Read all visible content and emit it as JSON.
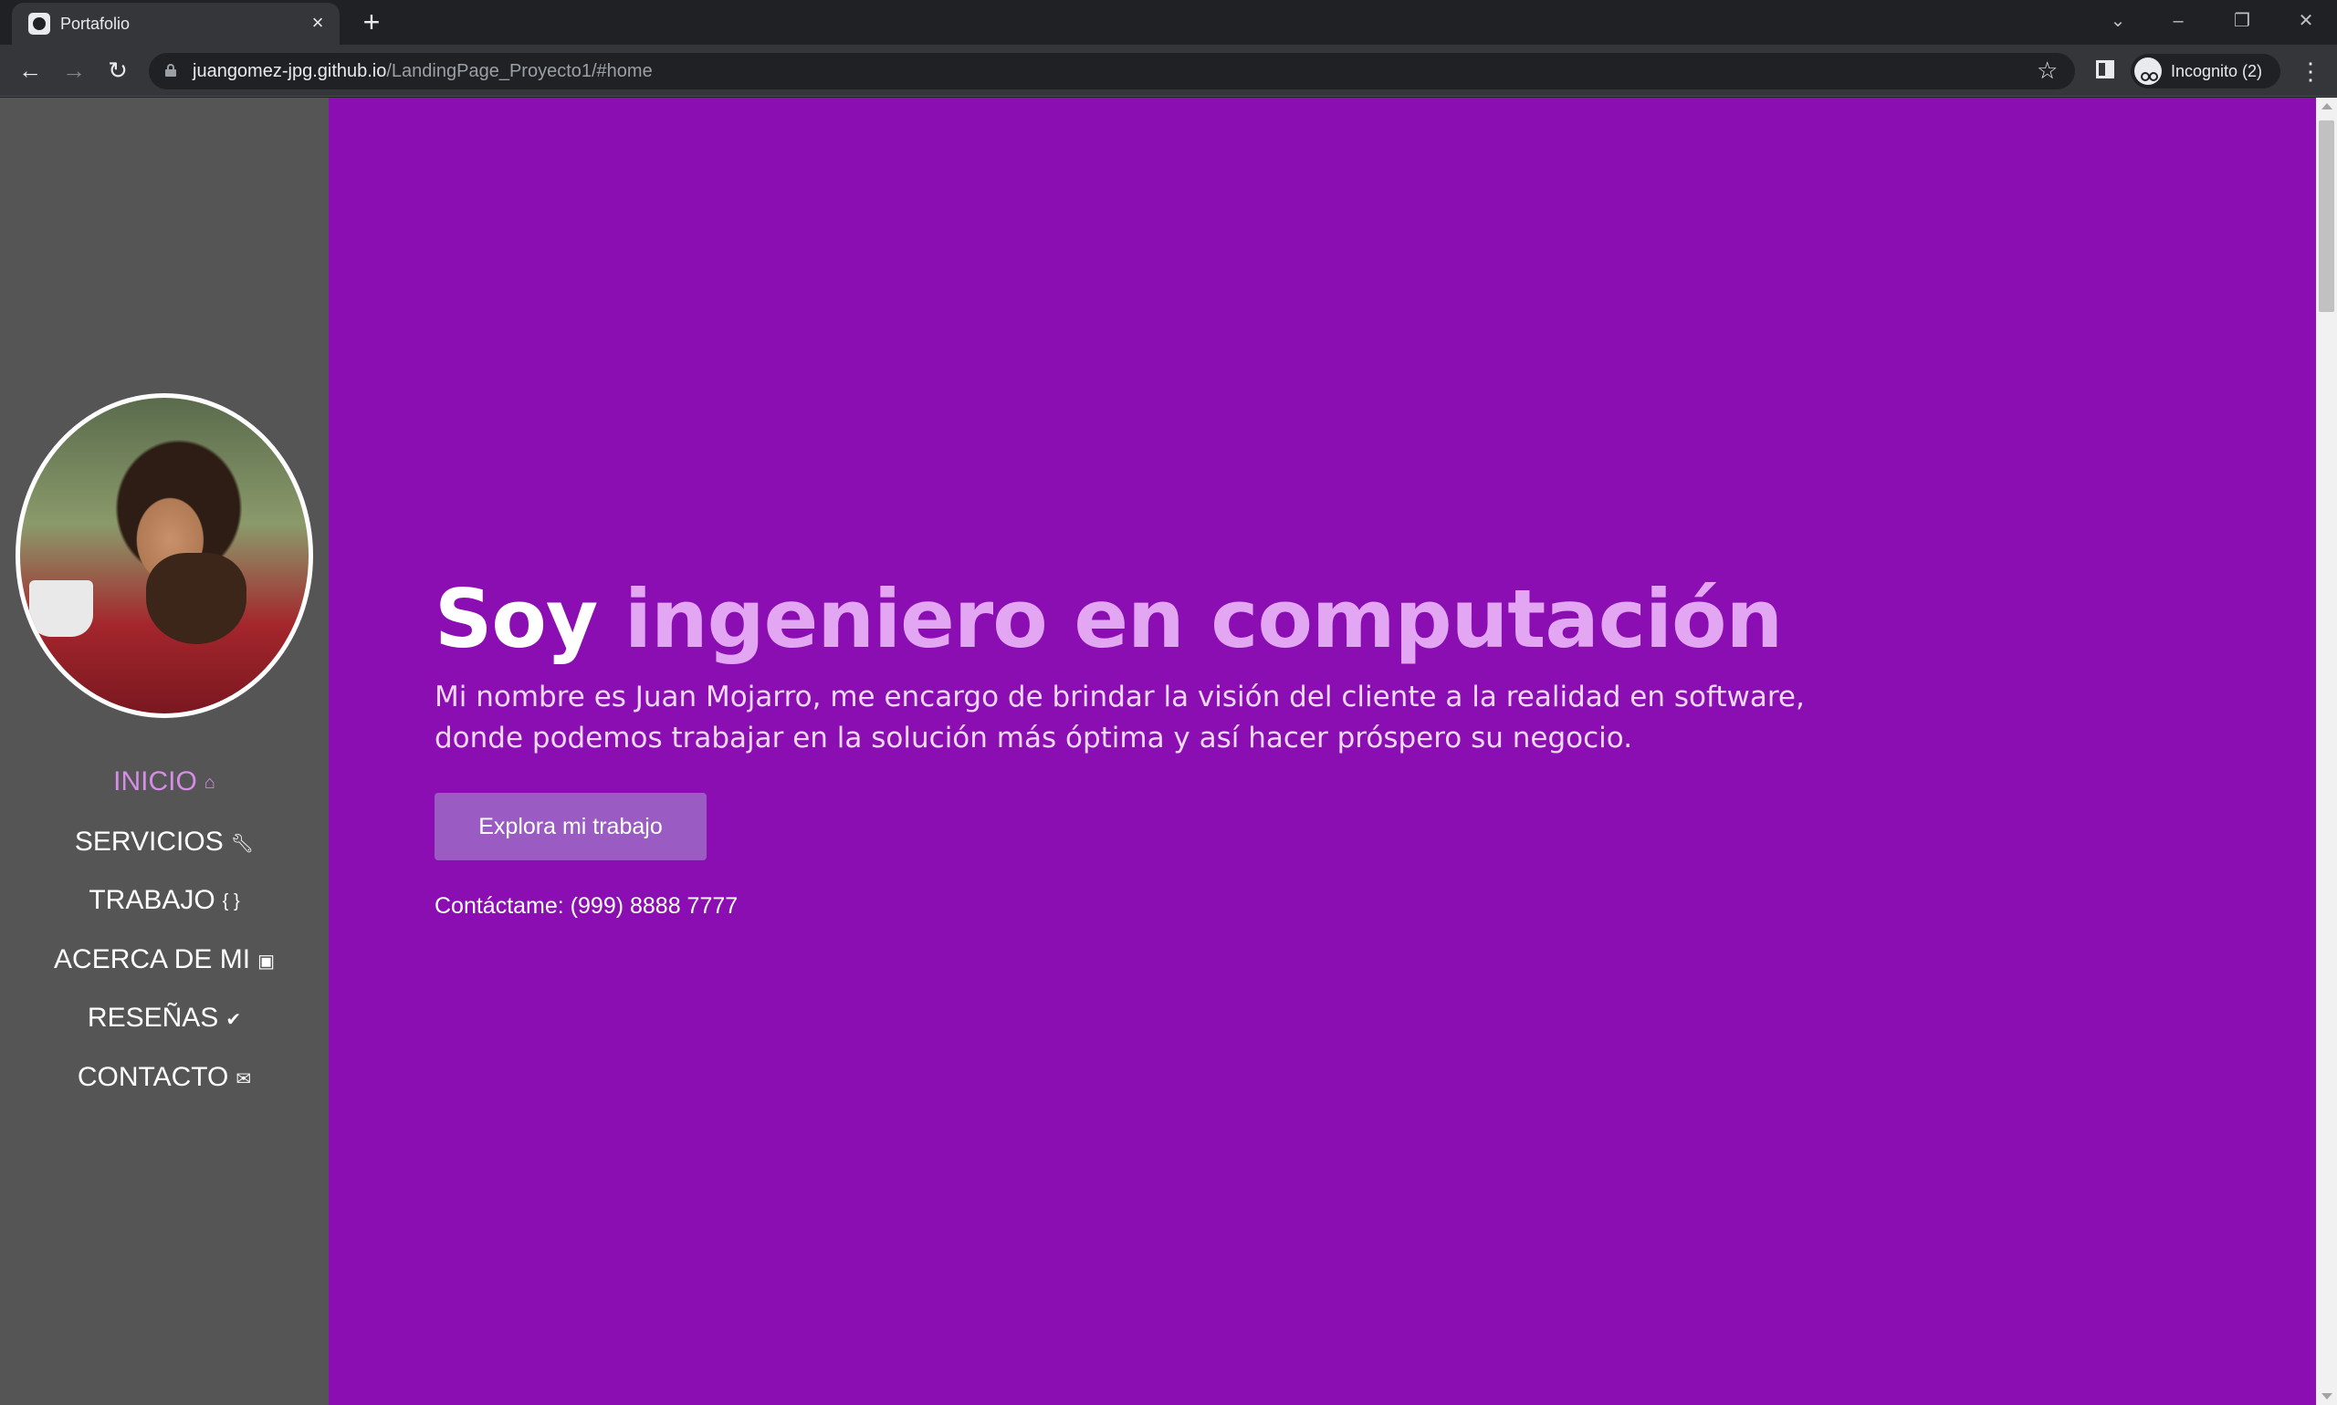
{
  "browser": {
    "tab_title": "Portafolio",
    "url_host": "juangomez-jpg.github.io",
    "url_path": "/LandingPage_Proyecto1/#home",
    "profile_label": "Incognito (2)"
  },
  "sidebar": {
    "nav": [
      {
        "label": "INICIO",
        "icon": "home-icon",
        "active": true
      },
      {
        "label": "SERVICIOS",
        "icon": "wrench-icon",
        "active": false
      },
      {
        "label": "TRABAJO",
        "icon": "braces-icon",
        "active": false
      },
      {
        "label": "ACERCA DE MI",
        "icon": "contact-card-icon",
        "active": false
      },
      {
        "label": "RESEÑAS",
        "icon": "check-badge-icon",
        "active": false
      },
      {
        "label": "CONTACTO",
        "icon": "mail-icon",
        "active": false
      }
    ]
  },
  "hero": {
    "title_prefix": "Soy",
    "title_accent": "ingeniero en computación",
    "description": "Mi nombre es Juan Mojarro, me encargo de brindar la visión del cliente a la realidad en software, donde podemos trabajar en la solución más óptima y así hacer próspero su negocio.",
    "cta_label": "Explora mi trabajo",
    "contact_text": "Contáctame: (999) 8888 7777"
  },
  "colors": {
    "page_bg": "#8a0eb1",
    "sidebar_bg": "#555555",
    "accent": "#e3a6f2",
    "active_nav": "#d68de8",
    "button_bg": "#9a5bc2"
  }
}
